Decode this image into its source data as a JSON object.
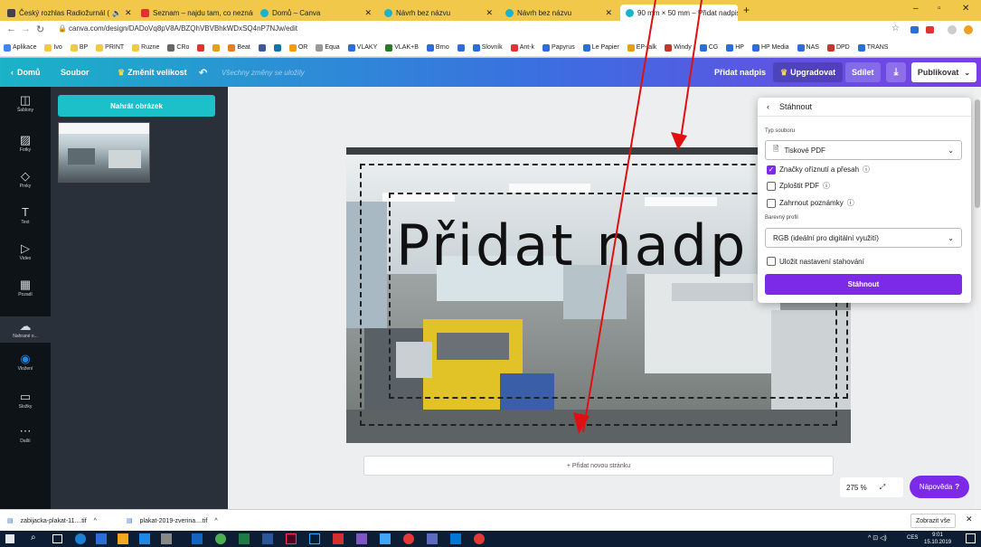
{
  "tabs": [
    {
      "label": "Český rozhlas Radiožurnál (",
      "color": "#444"
    },
    {
      "label": "Seznam – najdu tam, co neznám",
      "color": "#d33"
    },
    {
      "label": "Domů – Canva",
      "color": "#1ab3c7"
    },
    {
      "label": "Návrh bez názvu",
      "color": "#1ab3c7"
    },
    {
      "label": "Návrh bez názvu",
      "color": "#1ab3c7"
    },
    {
      "label": "90 mm × 50 mm – Přidat nadpis",
      "color": "#1ab3c7"
    }
  ],
  "address": {
    "url": "canva.com/design/DADoVq8pV8A/BZQhVBVBhkWDxSQ4nP7NJw/edit"
  },
  "bookmarks": [
    "Aplikace",
    "Ivo",
    "BP",
    "PRINT",
    "Ruzne",
    "CRo",
    "",
    "",
    "Beat",
    "",
    "",
    "OR",
    "Equa",
    "VLAKY",
    "VLAK+B",
    "Brno",
    "",
    "Slovník",
    "Ant-k",
    "Papyrus",
    "Le Papier",
    "EP-talk",
    "Windy",
    "CG",
    "HP",
    "HP Media",
    "NAS",
    "DPD",
    "TRANS"
  ],
  "topbar": {
    "home": "Domů",
    "file": "Soubor",
    "resize": "Změnit velikost",
    "saved": "Všechny změny se uložily",
    "add_title": "Přidat nadpis",
    "upgrade": "Upgradovat",
    "share": "Sdílet",
    "publish": "Publikovat"
  },
  "rail": [
    {
      "icon": "template-icon",
      "glyph": "◫",
      "label": "Šablony"
    },
    {
      "icon": "photo-icon",
      "glyph": "▨",
      "label": "Fotky"
    },
    {
      "icon": "elements-icon",
      "glyph": "◇",
      "label": "Prvky"
    },
    {
      "icon": "text-icon",
      "glyph": "T",
      "label": "Text"
    },
    {
      "icon": "video-icon",
      "glyph": "▷",
      "label": "Video"
    },
    {
      "icon": "background-icon",
      "glyph": "▦",
      "label": "Pozadí"
    },
    {
      "icon": "upload-icon",
      "glyph": "☁",
      "label": "Nahrané o..."
    },
    {
      "icon": "embed-icon",
      "glyph": "◉",
      "label": "Vložení"
    },
    {
      "icon": "folder-icon",
      "glyph": "▭",
      "label": "Složky"
    },
    {
      "icon": "more-icon",
      "glyph": "⋯",
      "label": "Další"
    }
  ],
  "panel": {
    "upload_button": "Nahrát obrázek"
  },
  "design": {
    "headline": "Přidat nadp"
  },
  "add_page": "+ Přidat novou stránku",
  "zoom": "275 %",
  "help": "Nápověda",
  "popup": {
    "title": "Stáhnout",
    "file_type_label": "Typ souboru",
    "file_type": "Tiskové PDF",
    "opt_crop": "Značky oříznutí a přesah",
    "opt_flatten": "Zploštit PDF",
    "opt_notes": "Zahrnout poznámky",
    "color_label": "Barevný profil",
    "color_profile": "RGB (ideální pro digitální využití)",
    "opt_save": "Uložit nastavení stahování",
    "download": "Stáhnout"
  },
  "downloads": {
    "file1": "zabijacka-plakat-11....tif",
    "file2": "plakat-2019-zverina....tif",
    "show_all": "Zobrazit vše"
  },
  "taskbar": {
    "lang": "CES",
    "time": "9:01",
    "date": "15.10.2019"
  }
}
